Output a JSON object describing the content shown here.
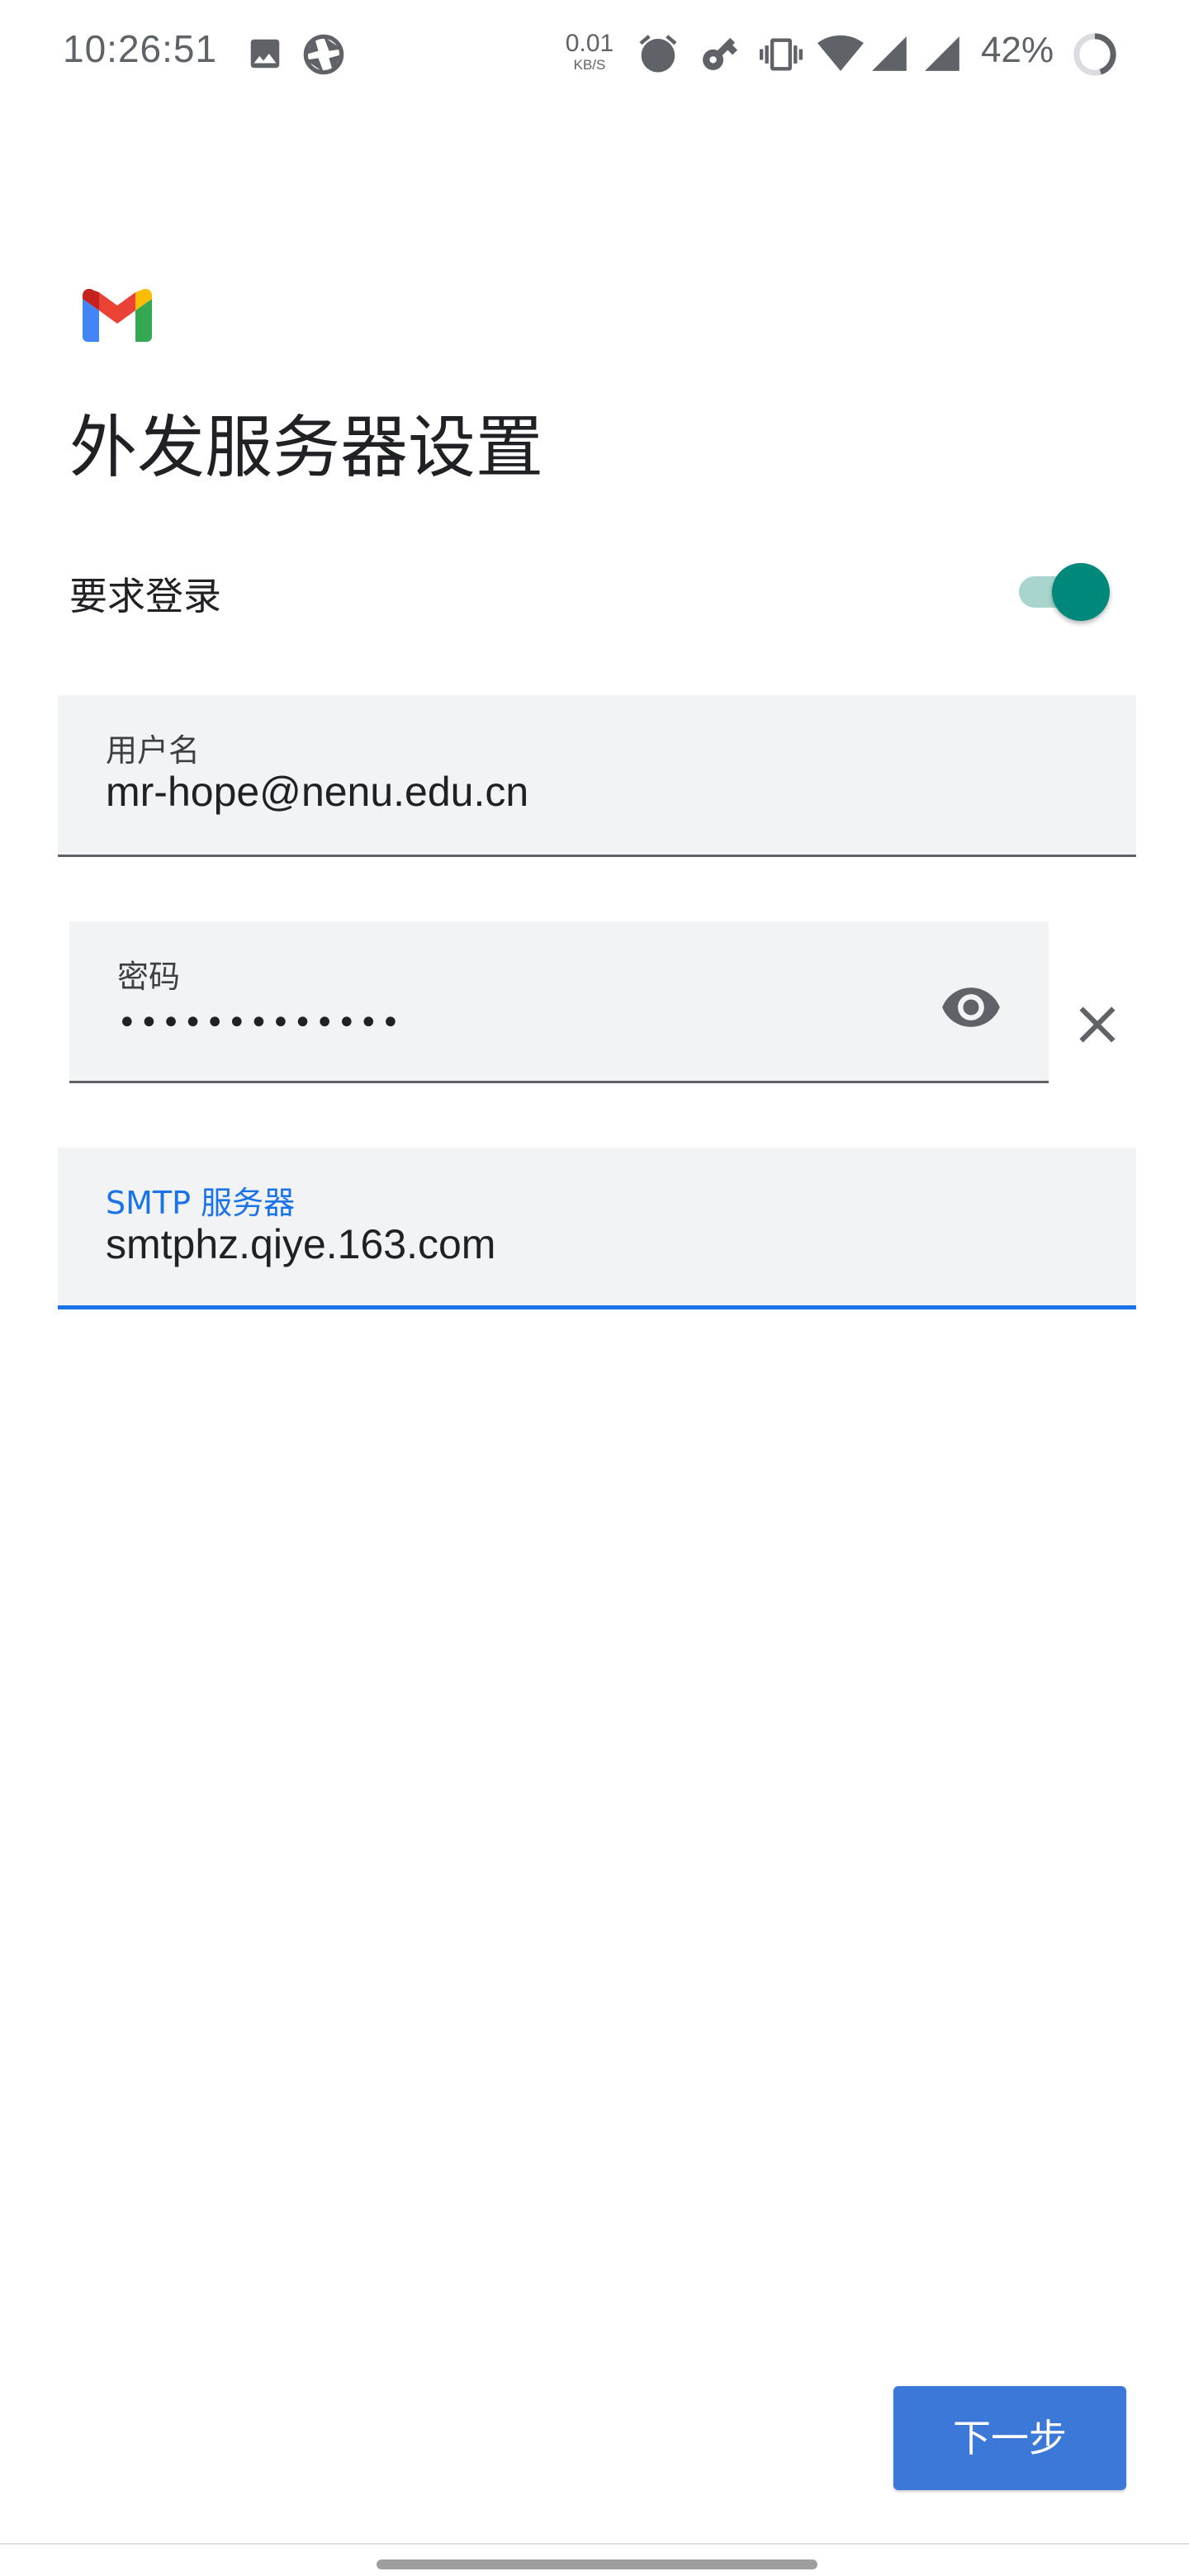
{
  "status_bar": {
    "time": "10:26:51",
    "speed_value": "0.01",
    "speed_unit": "KB/S",
    "battery": "42%",
    "icons": [
      "image-icon",
      "aperture-icon",
      "alarm-icon",
      "key-icon",
      "vibrate-icon",
      "wifi-icon",
      "signal-icon",
      "signal-icon-2",
      "battery-ring-icon"
    ]
  },
  "app": {
    "logo": "gmail-logo"
  },
  "page": {
    "title": "外发服务器设置"
  },
  "require_login": {
    "label": "要求登录",
    "enabled": true
  },
  "username": {
    "label": "用户名",
    "value": "mr-hope@nenu.edu.cn"
  },
  "password": {
    "label": "密码",
    "masked_value": "•••••••••••••",
    "toggle_icon": "eye-icon",
    "clear_icon": "close-icon"
  },
  "smtp": {
    "label": "SMTP 服务器",
    "value": "smtphz.qiye.163.com"
  },
  "actions": {
    "next_label": "下一步"
  },
  "colors": {
    "accent": "#1a73e8",
    "button": "#3b78d8",
    "toggle_on": "#00897b",
    "toggle_track": "#a8d5cd",
    "field_bg": "#f1f3f4"
  }
}
